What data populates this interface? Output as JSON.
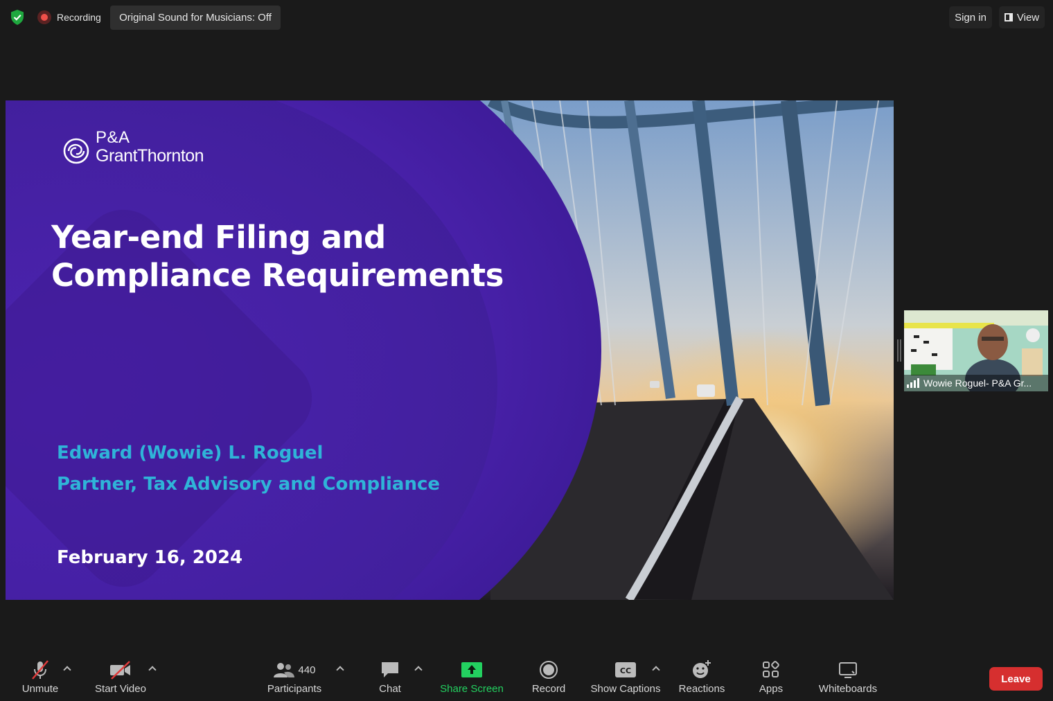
{
  "topbar": {
    "recording_label": "Recording",
    "original_sound_label": "Original Sound for Musicians: Off",
    "sign_in_label": "Sign in",
    "view_label": "View"
  },
  "slide": {
    "logo_line1": "P&A",
    "logo_line2": "GrantThornton",
    "title_line1": "Year-end Filing and",
    "title_line2": "Compliance Requirements",
    "presenter_name": "Edward (Wowie) L. Roguel",
    "presenter_role": "Partner, Tax Advisory and Compliance",
    "date": "February 16, 2024",
    "colors": {
      "purple": "#4b22ad",
      "accent_cyan": "#2fb4d8"
    }
  },
  "thumbnail": {
    "participant_name": "Wowie Roguel- P&A Gr..."
  },
  "toolbar": {
    "unmute_label": "Unmute",
    "start_video_label": "Start Video",
    "participants_label": "Participants",
    "participants_count": "440",
    "chat_label": "Chat",
    "share_screen_label": "Share Screen",
    "record_label": "Record",
    "show_captions_label": "Show Captions",
    "reactions_label": "Reactions",
    "apps_label": "Apps",
    "whiteboards_label": "Whiteboards",
    "leave_label": "Leave",
    "colors": {
      "share_green": "#23d160",
      "leave_red": "#d62f2f"
    }
  }
}
